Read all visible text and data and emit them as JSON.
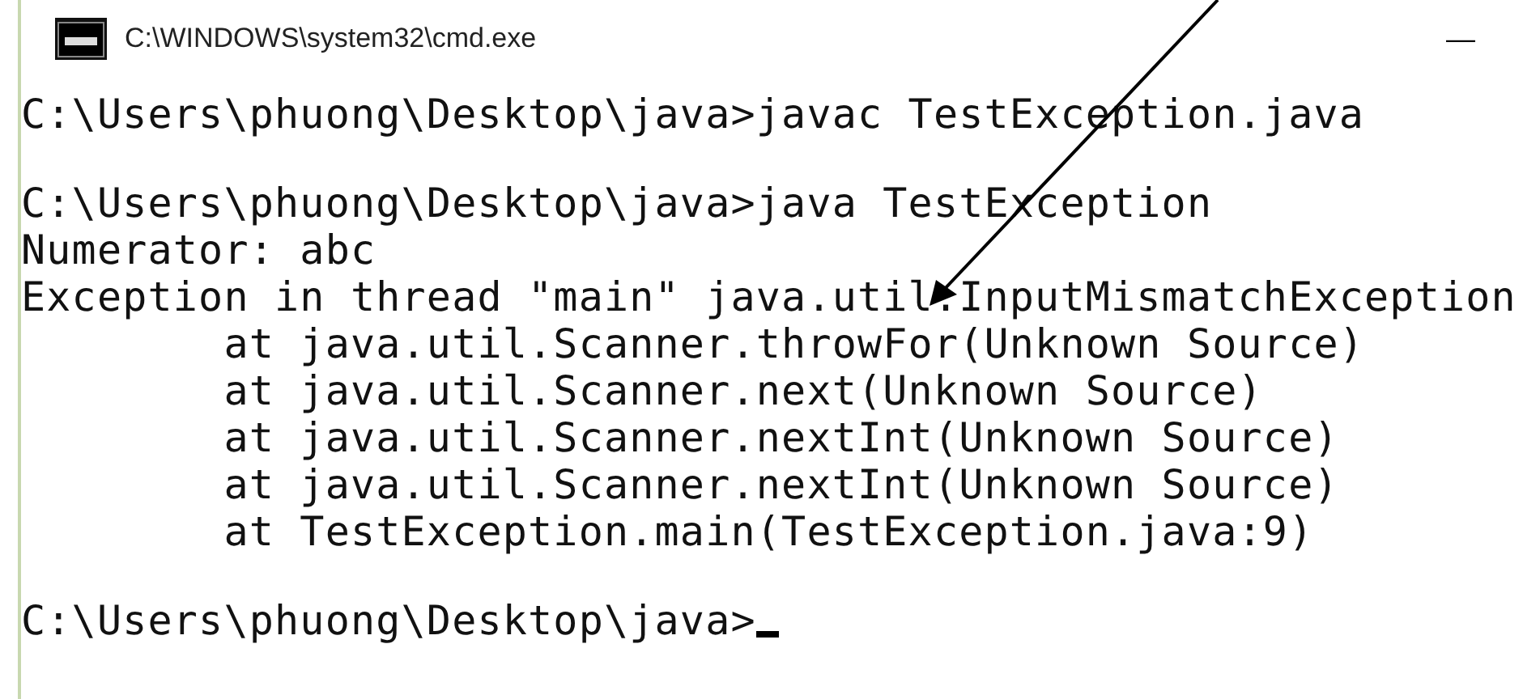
{
  "window": {
    "title": "C:\\WINDOWS\\system32\\cmd.exe",
    "minimize": "—"
  },
  "console": {
    "blocks": [
      {
        "lines": [
          "C:\\Users\\phuong\\Desktop\\java>javac TestException.java"
        ]
      },
      {
        "lines": [
          "C:\\Users\\phuong\\Desktop\\java>java TestException",
          "Numerator: abc",
          "Exception in thread \"main\" java.util.InputMismatchException",
          "        at java.util.Scanner.throwFor(Unknown Source)",
          "        at java.util.Scanner.next(Unknown Source)",
          "        at java.util.Scanner.nextInt(Unknown Source)",
          "        at java.util.Scanner.nextInt(Unknown Source)",
          "        at TestException.main(TestException.java:9)"
        ]
      },
      {
        "lines": [
          "C:\\Users\\phuong\\Desktop\\java>"
        ]
      }
    ],
    "cursor_visible": true
  }
}
